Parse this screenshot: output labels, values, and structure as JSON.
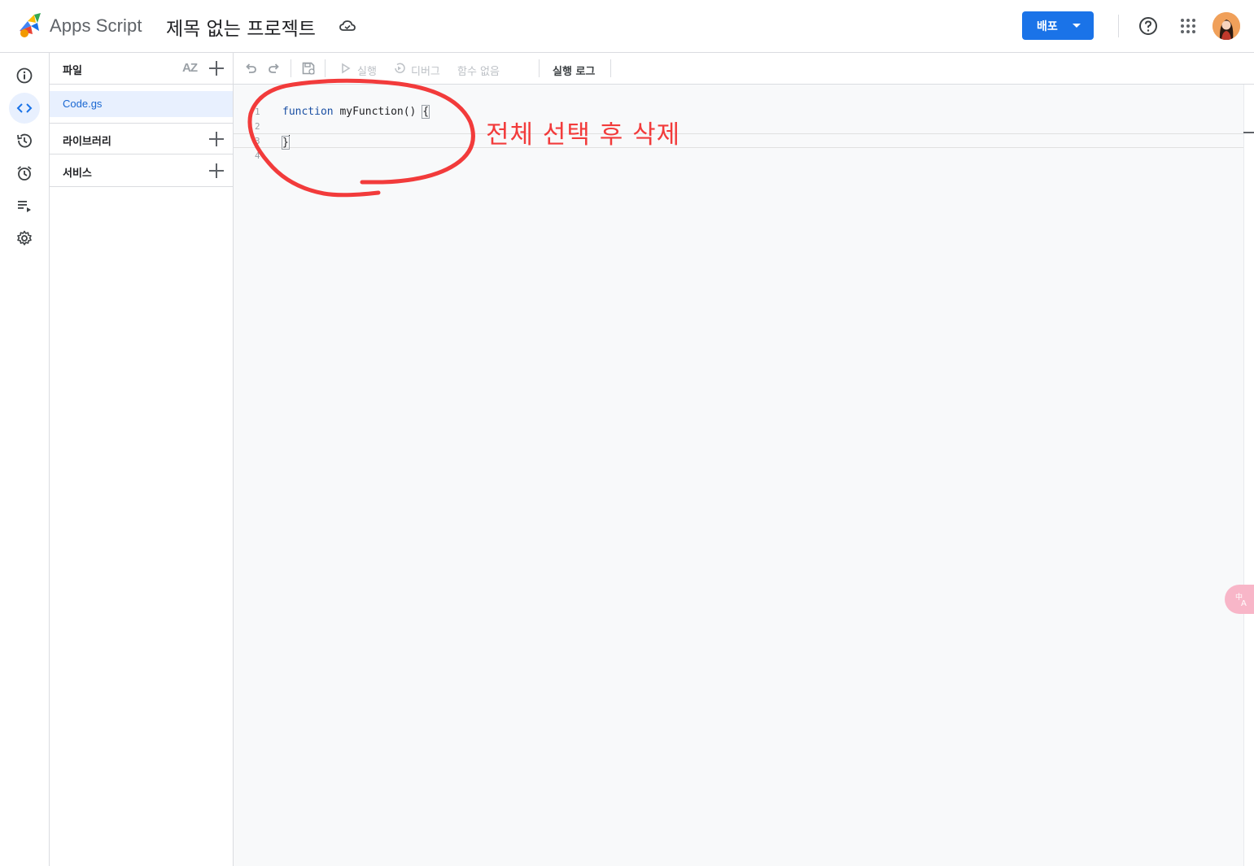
{
  "header": {
    "app_name": "Apps Script",
    "project_title": "제목 없는 프로젝트",
    "deploy_label": "배포"
  },
  "rail": {
    "items": [
      "overview-icon",
      "editor-icon",
      "history-icon",
      "triggers-icon",
      "executions-icon",
      "settings-icon"
    ],
    "active": "editor-icon"
  },
  "files_panel": {
    "files_label": "파일",
    "sort_label": "AZ",
    "files": [
      "Code.gs"
    ],
    "libraries_label": "라이브러리",
    "services_label": "서비스"
  },
  "toolbar": {
    "run_label": "실행",
    "debug_label": "디버그",
    "function_label": "함수 없음",
    "exec_log_label": "실행 로그"
  },
  "editor": {
    "line_numbers": [
      "1",
      "2",
      "3",
      "4"
    ],
    "line1_keyword": "function",
    "line1_rest": " myFunction() ",
    "line1_brace": "{",
    "line3_brace": "}"
  },
  "annotation": {
    "text": "전체 선택 후 삭제",
    "color": "#f23b3b"
  },
  "colors": {
    "accent": "#1a73e8",
    "selected_bg": "#e8f0fe"
  }
}
